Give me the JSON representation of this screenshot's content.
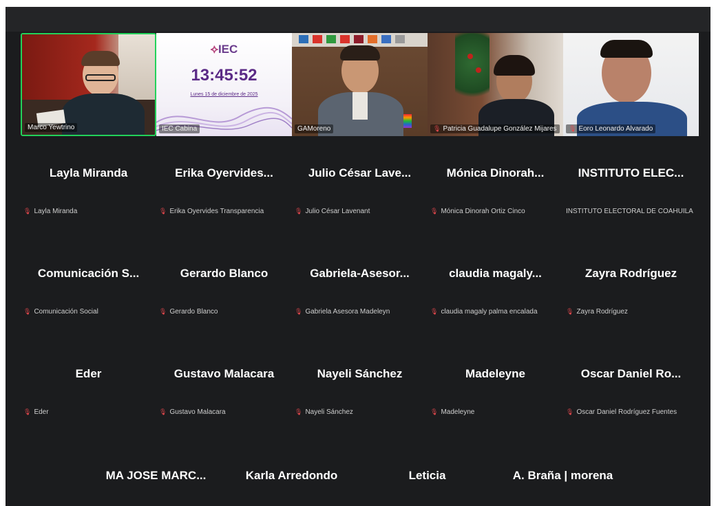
{
  "colors": {
    "background": "#1b1c1e",
    "active_speaker": "#22d25a",
    "muted_mic": "#e5484d",
    "name_text": "#ffffff"
  },
  "video_tiles": [
    {
      "name": "Marco Yewtrino",
      "muted": false,
      "active": true
    },
    {
      "name": "IEC Cabina",
      "muted": false,
      "active": false
    },
    {
      "name": "GAMoreno",
      "muted": false,
      "active": false
    },
    {
      "name": "Patricia Guadalupe González Mijares",
      "muted": true,
      "active": false
    },
    {
      "name": "Eoro Leonardo Alvarado",
      "muted": true,
      "active": false
    }
  ],
  "iec_screen": {
    "logo": "IEC",
    "time": "13:45:52",
    "date": "Lunes 15 de diciembre de 2025"
  },
  "participants": [
    [
      {
        "display": "Layla Miranda",
        "full": "Layla Miranda",
        "muted": true
      },
      {
        "display": "Erika Oyervides...",
        "full": "Erika Oyervides Transparencia",
        "muted": true
      },
      {
        "display": "Julio César Lave...",
        "full": "Julio César Lavenant",
        "muted": true
      },
      {
        "display": "Mónica Dinorah...",
        "full": "Mónica Dinorah Ortiz Cinco",
        "muted": true
      },
      {
        "display": "INSTITUTO ELEC...",
        "full": "INSTITUTO ELECTORAL DE COAHUILA",
        "muted": false
      }
    ],
    [
      {
        "display": "Comunicación S...",
        "full": "Comunicación Social",
        "muted": true
      },
      {
        "display": "Gerardo Blanco",
        "full": "Gerardo Blanco",
        "muted": true
      },
      {
        "display": "Gabriela-Asesor...",
        "full": "Gabriela Asesora Madeleyn",
        "muted": true
      },
      {
        "display": "claudia magaly...",
        "full": "claudia magaly palma encalada",
        "muted": true
      },
      {
        "display": "Zayra Rodríguez",
        "full": "Zayra Rodríguez",
        "muted": true
      }
    ],
    [
      {
        "display": "Eder",
        "full": "Eder",
        "muted": true
      },
      {
        "display": "Gustavo Malacara",
        "full": "Gustavo Malacara",
        "muted": true
      },
      {
        "display": "Nayeli Sánchez",
        "full": "Nayeli Sánchez",
        "muted": true
      },
      {
        "display": "Madeleyne",
        "full": "Madeleyne",
        "muted": true
      },
      {
        "display": "Oscar Daniel Ro...",
        "full": "Oscar Daniel Rodríguez Fuentes",
        "muted": true
      }
    ],
    [
      {
        "display": "MA JOSE MARC...",
        "full": "",
        "muted": false
      },
      {
        "display": "Karla Arredondo",
        "full": "",
        "muted": false
      },
      {
        "display": "Leticia",
        "full": "",
        "muted": false
      },
      {
        "display": "A. Braña | morena",
        "full": "",
        "muted": false
      }
    ]
  ]
}
